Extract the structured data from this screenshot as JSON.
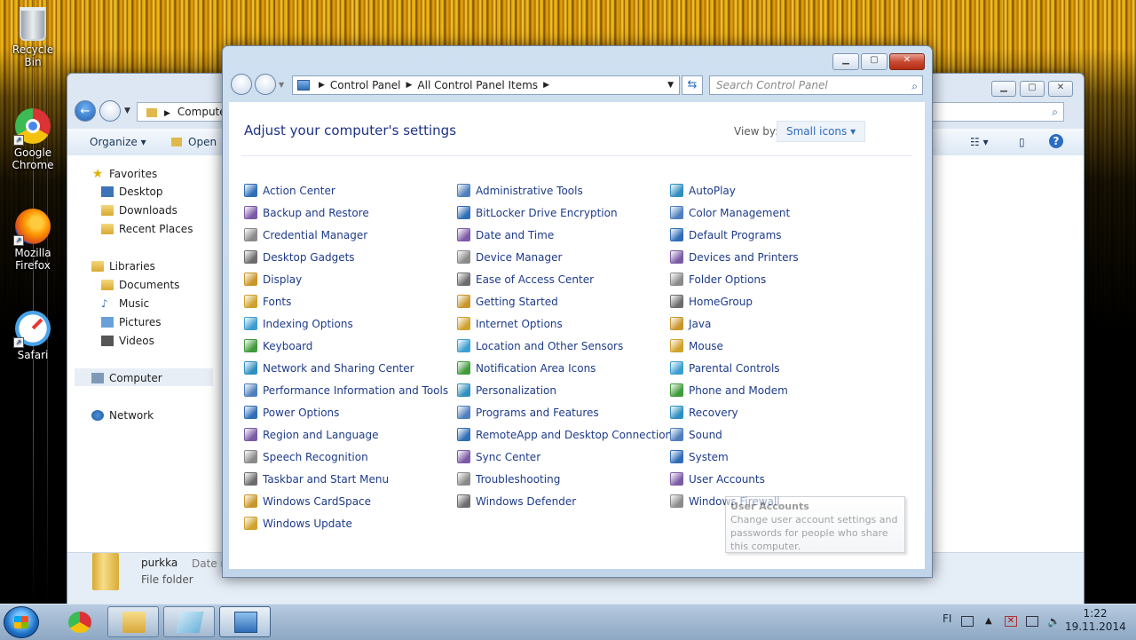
{
  "desktop": {
    "icons": [
      {
        "label": "Recycle Bin",
        "icon": "recycle-bin-icon"
      },
      {
        "label": "Google\nChrome",
        "icon": "chrome-icon"
      },
      {
        "label": "Mozilla\nFirefox",
        "icon": "firefox-icon"
      },
      {
        "label": "Safari",
        "icon": "safari-icon"
      }
    ]
  },
  "explorer": {
    "address": "Computer",
    "toolbar": {
      "organize": "Organize ▾",
      "open": "Open"
    },
    "sidebar": {
      "favorites": "Favorites",
      "desktop": "Desktop",
      "downloads": "Downloads",
      "recent_places": "Recent Places",
      "libraries": "Libraries",
      "documents": "Documents",
      "music": "Music",
      "pictures": "Pictures",
      "videos": "Videos",
      "computer": "Computer",
      "network": "Network"
    },
    "file": {
      "name": "purkka",
      "type": "File folder",
      "date_label": "Date n"
    }
  },
  "control_panel": {
    "breadcrumb": [
      "Control Panel",
      "All Control Panel Items"
    ],
    "search_placeholder": "Search Control Panel",
    "heading": "Adjust your computer's settings",
    "view_by_label": "View by:",
    "view_by_value": "Small icons ▾",
    "columns": [
      [
        "Action Center",
        "Backup and Restore",
        "Credential Manager",
        "Desktop Gadgets",
        "Display",
        "Fonts",
        "Indexing Options",
        "Keyboard",
        "Network and Sharing Center",
        "Performance Information and Tools",
        "Power Options",
        "Region and Language",
        "Speech Recognition",
        "Taskbar and Start Menu",
        "Windows CardSpace",
        "Windows Update"
      ],
      [
        "Administrative Tools",
        "BitLocker Drive Encryption",
        "Date and Time",
        "Device Manager",
        "Ease of Access Center",
        "Getting Started",
        "Internet Options",
        "Location and Other Sensors",
        "Notification Area Icons",
        "Personalization",
        "Programs and Features",
        "RemoteApp and Desktop Connections",
        "Sync Center",
        "Troubleshooting",
        "Windows Defender"
      ],
      [
        "AutoPlay",
        "Color Management",
        "Default Programs",
        "Devices and Printers",
        "Folder Options",
        "HomeGroup",
        "Java",
        "Mouse",
        "Parental Controls",
        "Phone and Modem",
        "Recovery",
        "Sound",
        "System",
        "User Accounts",
        "Windows Firewall"
      ]
    ],
    "tooltip": {
      "title": "User Accounts",
      "text": "Change user account settings and passwords for people who share this computer."
    }
  },
  "taskbar": {
    "language": "FI",
    "time": "1:22",
    "date": "19.11.2014"
  }
}
